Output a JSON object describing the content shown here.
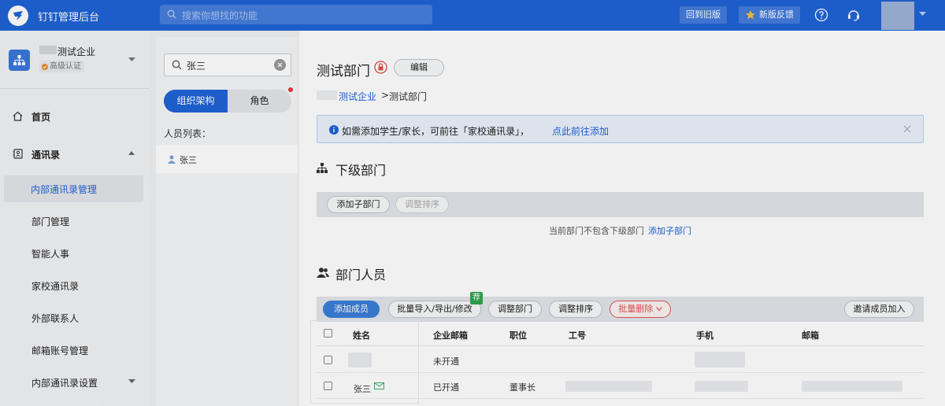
{
  "topbar": {
    "app_title": "钉钉管理后台",
    "search_placeholder": "搜索你想找的功能",
    "back_old_label": "回到旧版",
    "feedback_label": "新版反馈"
  },
  "sidebar": {
    "enterprise_name": "测试企业",
    "enterprise_badge": "高级认证",
    "items": [
      {
        "label": "首页"
      },
      {
        "label": "通讯录"
      },
      {
        "label": "内部通讯录管理"
      },
      {
        "label": "部门管理"
      },
      {
        "label": "智能人事"
      },
      {
        "label": "家校通讯录"
      },
      {
        "label": "外部联系人"
      },
      {
        "label": "邮箱账号管理"
      },
      {
        "label": "内部通讯录设置"
      }
    ]
  },
  "middle": {
    "search_value": "张三",
    "tabs": [
      {
        "label": "组织架构"
      },
      {
        "label": "角色"
      }
    ],
    "list_label": "人员列表：",
    "people": [
      {
        "name": "张三"
      }
    ]
  },
  "main": {
    "dept_title": "测试部门",
    "edit_label": "编辑",
    "breadcrumb": {
      "root": "测试企业",
      "sep": ">",
      "current": "测试部门"
    },
    "notice": {
      "text": "如需添加学生/家长，可前往「家校通讯录」，",
      "link": "点此前往添加"
    },
    "sub_dept": {
      "title": "下级部门",
      "add_label": "添加子部门",
      "sort_label": "调整排序",
      "empty_tip": "当前部门不包含下级部门",
      "empty_link": "添加子部门"
    },
    "members": {
      "title": "部门人员",
      "toolbar": {
        "add": "添加成员",
        "batch": "批量导入/导出/修改",
        "recommend": "荐",
        "adjust_dept": "调整部门",
        "sort": "调整排序",
        "batch_delete": "批量删除",
        "invite": "邀请成员加入"
      },
      "columns": [
        "姓名",
        "企业邮箱",
        "职位",
        "工号",
        "手机",
        "邮箱"
      ],
      "rows": [
        {
          "name": "",
          "corp_mail": "未开通",
          "position": ""
        },
        {
          "name": "张三",
          "corp_mail": "已开通",
          "position": "董事长"
        }
      ]
    }
  },
  "colors": {
    "brand": "#1f63d6",
    "danger": "#e05555",
    "recommend": "#2ea44f"
  }
}
